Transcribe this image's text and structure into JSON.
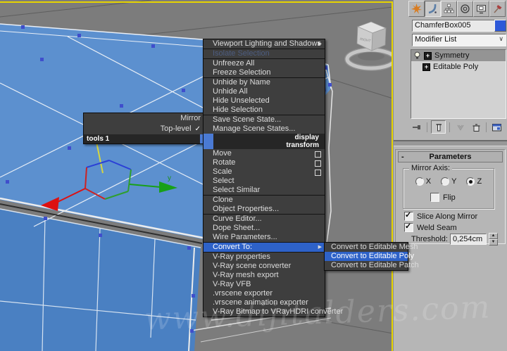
{
  "colors": {
    "menu_highlight": "#2e62c8",
    "quad_accent": "#4a7ad4",
    "active_viewport_border": "#e6d400",
    "object_color": "#2d58d8",
    "box_top_face": "#5c90cf",
    "box_front_face": "#4a80c2"
  },
  "viewport": {
    "watermark": "www.dijitalders.com",
    "axis_y_label": "y",
    "viewcube_label": "RIGHT"
  },
  "quad": {
    "left_title": "tools 1",
    "left_items": [
      {
        "label": "Mirror"
      },
      {
        "label": "Top-level",
        "check": "✓"
      }
    ]
  },
  "menu": {
    "items": [
      {
        "label": "Viewport Lighting and Shadows",
        "has_submenu": true
      },
      {
        "label": "Isolate Selection",
        "disabled": true
      },
      {
        "label": "Unfreeze All"
      },
      {
        "label": "Freeze Selection"
      },
      {
        "label": "Unhide by Name"
      },
      {
        "label": "Unhide All"
      },
      {
        "label": "Hide Unselected"
      },
      {
        "label": "Hide Selection"
      },
      {
        "label": "Save Scene State..."
      },
      {
        "label": "Manage Scene States..."
      },
      {
        "label": "display",
        "quad_title": true
      },
      {
        "label": "transform",
        "quad_title": true
      },
      {
        "label": "Move",
        "has_settings": true
      },
      {
        "label": "Rotate",
        "has_settings": true
      },
      {
        "label": "Scale",
        "has_settings": true
      },
      {
        "label": "Select"
      },
      {
        "label": "Select Similar"
      },
      {
        "label": "Clone"
      },
      {
        "label": "Object Properties..."
      },
      {
        "label": "Curve Editor..."
      },
      {
        "label": "Dope Sheet..."
      },
      {
        "label": "Wire Parameters..."
      },
      {
        "label": "Convert To:",
        "has_submenu": true,
        "highlighted": true
      },
      {
        "label": "V-Ray properties"
      },
      {
        "label": "V-Ray scene converter"
      },
      {
        "label": "V-Ray mesh export"
      },
      {
        "label": "V-Ray VFB"
      },
      {
        "label": ".vrscene exporter"
      },
      {
        "label": ".vrscene animation exporter"
      },
      {
        "label": "V-Ray Bitmap to VRayHDRI converter"
      }
    ]
  },
  "submenu": {
    "items": [
      {
        "label": "Convert to Editable Mesh",
        "selected": false
      },
      {
        "label": "Convert to Editable Poly",
        "selected": true
      },
      {
        "label": "Convert to Editable Patch",
        "selected": false
      }
    ]
  },
  "panel": {
    "object_name": "ChamferBox005",
    "object_color": "#2d58d8",
    "modifier_list_label": "Modifier List",
    "stack_rows": [
      {
        "label": "Symmetry",
        "selected": true
      },
      {
        "label": "Editable Poly",
        "selected": false
      }
    ],
    "parameters": {
      "title": "Parameters",
      "collapse_glyph": "-",
      "mirror_axis_label": "Mirror Axis:",
      "axes": [
        {
          "label": "X",
          "selected": false
        },
        {
          "label": "Y",
          "selected": false
        },
        {
          "label": "Z",
          "selected": true
        }
      ],
      "flip_label": "Flip",
      "flip_checked": false,
      "slice_label": "Slice Along Mirror",
      "slice_checked": true,
      "weld_label": "Weld Seam",
      "weld_checked": true,
      "threshold_label": "Threshold:",
      "threshold_value": "0,254cm"
    }
  }
}
